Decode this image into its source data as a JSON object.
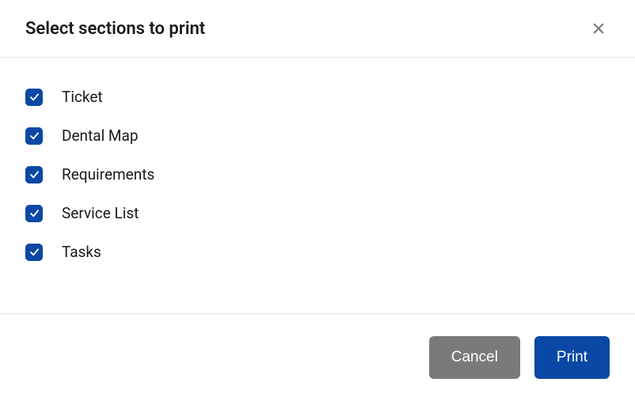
{
  "dialog": {
    "title": "Select sections to print"
  },
  "sections": [
    {
      "label": "Ticket",
      "checked": true
    },
    {
      "label": "Dental Map",
      "checked": true
    },
    {
      "label": "Requirements",
      "checked": true
    },
    {
      "label": "Service List",
      "checked": true
    },
    {
      "label": "Tasks",
      "checked": true
    }
  ],
  "footer": {
    "cancel_label": "Cancel",
    "print_label": "Print"
  }
}
